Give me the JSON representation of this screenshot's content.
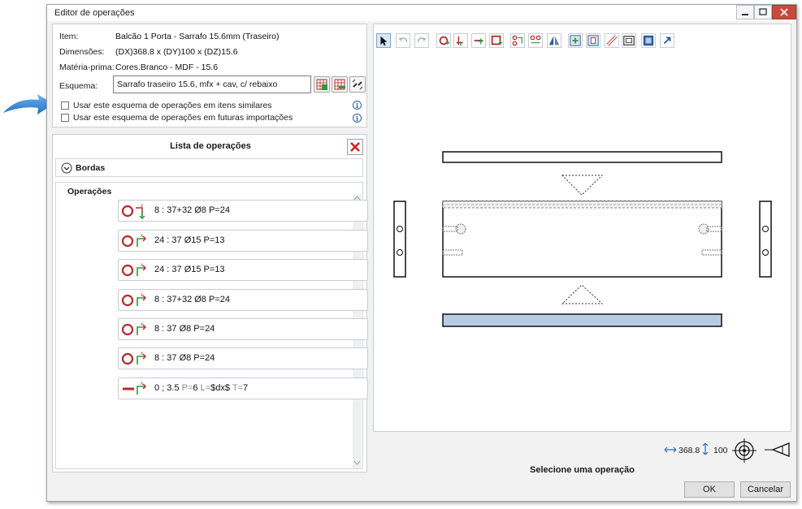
{
  "window": {
    "title": "Editor de operações"
  },
  "info": {
    "item_label": "Item:",
    "item_value": "Balcão 1 Porta - Sarrafo 15.6mm (Traseiro)",
    "dim_label": "Dimensões:",
    "dim_value": "(DX)368.8 x (DY)100 x (DZ)15.6",
    "material_label": "Matéria-prima:",
    "material_value": "Cores.Branco - MDF - 15.6",
    "scheme_label": "Esquema:",
    "scheme_value": "Sarrafo traseiro 15.6, mfx + cav, c/ rebaixo"
  },
  "options": {
    "similar_label": "Usar este esquema de operações em itens similares",
    "future_label": "Usar este esquema de operações em futuras importações"
  },
  "list": {
    "title": "Lista de operações",
    "edges_label": "Bordas",
    "operations_label": "Operações",
    "operations": [
      {
        "a": "8 : 37+32 Ø8 P=24"
      },
      {
        "a": "24 : 37 Ø15 P=13"
      },
      {
        "a": "24 : 37 Ø15 P=13"
      },
      {
        "a": "8 : 37+32 Ø8 P=24"
      },
      {
        "a": "8 : 37 Ø8 P=24"
      },
      {
        "a": "8 : 37 Ø8 P=24"
      }
    ],
    "groove": {
      "a": "0 ; 3.5",
      "p_lbl": "P=",
      "p": "6",
      "l_lbl": "L=",
      "l": "$dx$",
      "t_lbl": "T=",
      "t": "7"
    }
  },
  "status": {
    "width": "368.8",
    "height": "100",
    "message": "Selecione uma operação"
  },
  "buttons": {
    "ok": "OK",
    "cancel": "Cancelar"
  },
  "colors": {
    "accent_red": "#b52a2a",
    "accent_green": "#2d9a3a",
    "highlight_blue": "#b9cbe4",
    "arrow_blue": "#2b86d6"
  }
}
